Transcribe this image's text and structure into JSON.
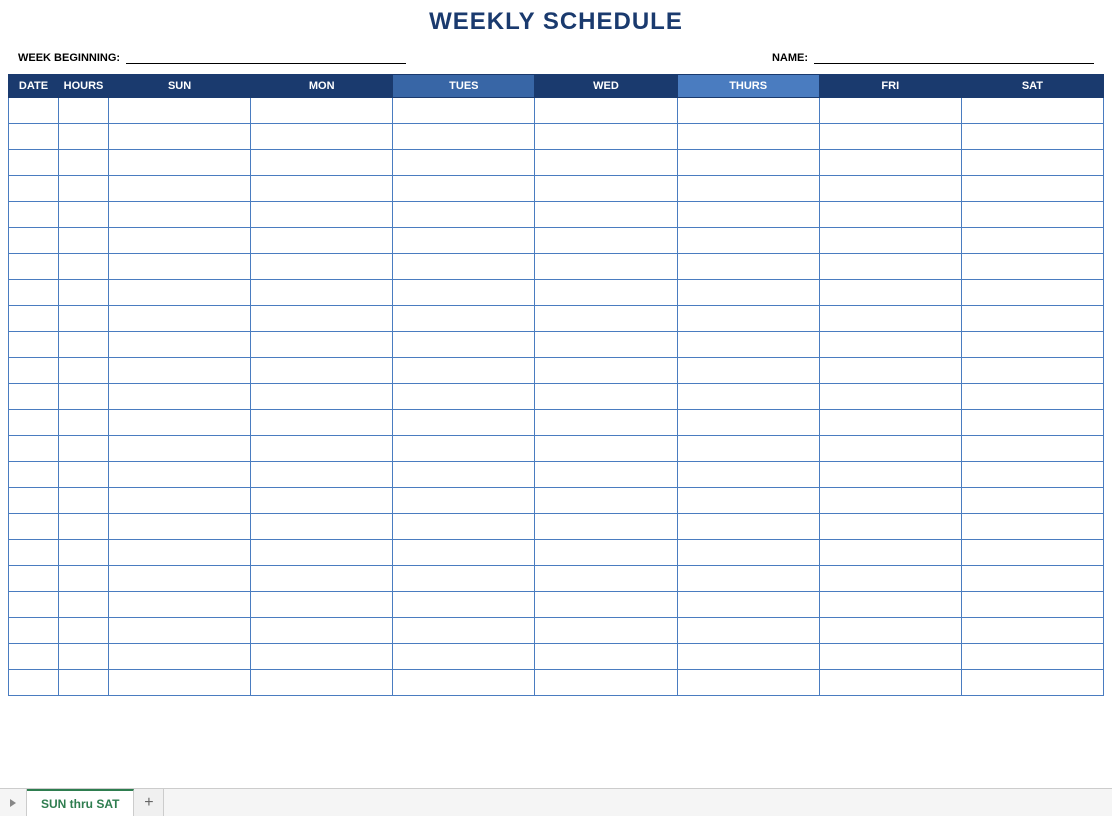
{
  "title": "WEEKLY SCHEDULE",
  "info": {
    "week_beginning_label": "WEEK BEGINNING:",
    "week_beginning_value": "",
    "name_label": "NAME:",
    "name_value": ""
  },
  "headers": {
    "date": "DATE",
    "hours": "HOURS",
    "sun": "SUN",
    "mon": "MON",
    "tues": "TUES",
    "wed": "WED",
    "thurs": "THURS",
    "fri": "FRI",
    "sat": "SAT"
  },
  "row_count": 23,
  "sheet_tabs": {
    "active": "SUN thru SAT"
  }
}
